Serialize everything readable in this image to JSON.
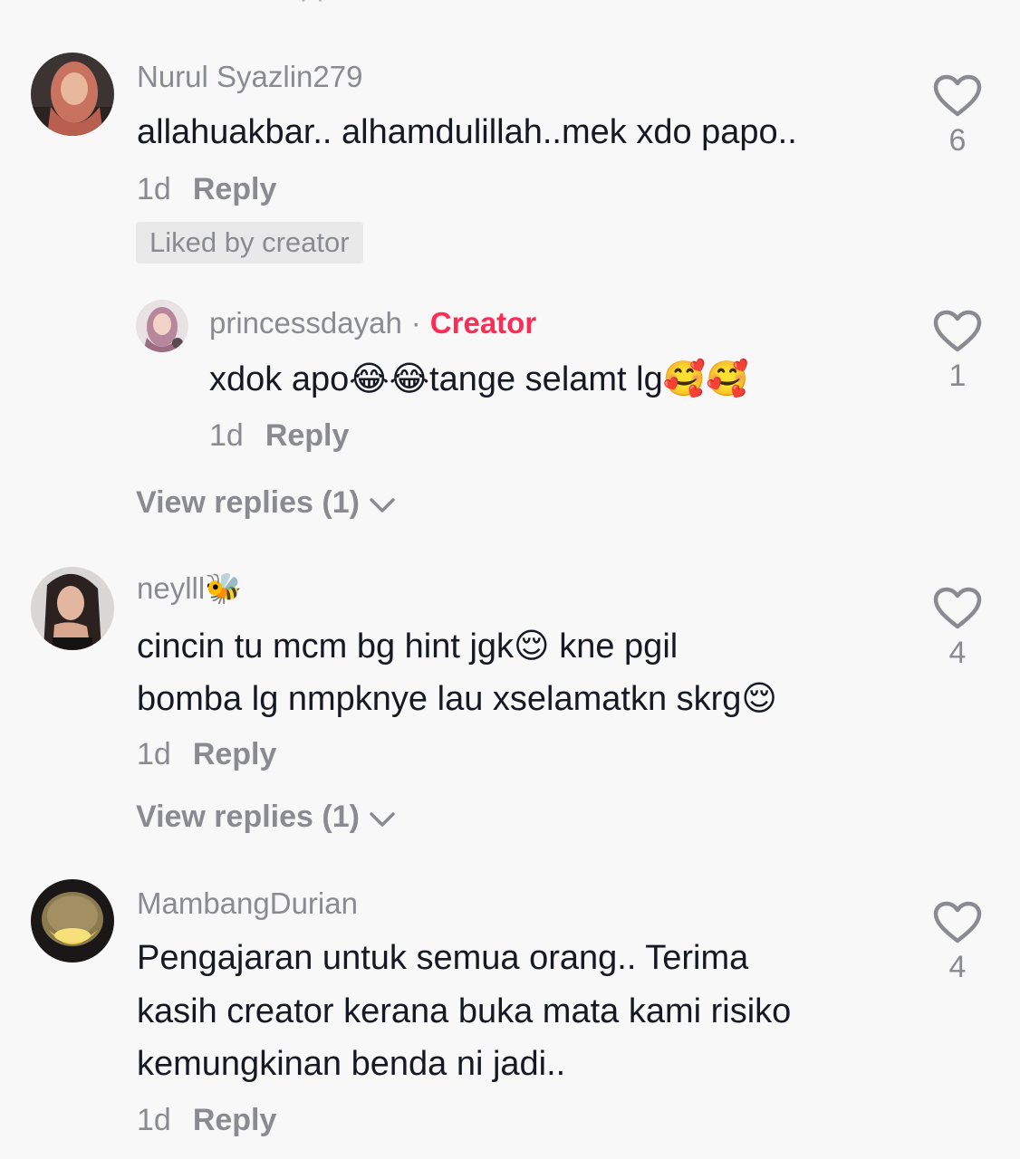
{
  "comments": [
    {
      "username": "Nurul Syazlin279",
      "text": "allahuakbar.. alhamdulillah..mek xdo papo..",
      "time": "1d",
      "reply_label": "Reply",
      "badge": "Liked by creator",
      "likes": "6"
    },
    {
      "username": "neylll🐝",
      "text_line1": "cincin tu mcm bg hint jgk😌 kne pgil",
      "text_line2": "bomba lg nmpknye lau xselamatkn skrg😌",
      "time": "1d",
      "reply_label": "Reply",
      "view_replies": "View replies (1)",
      "likes": "4"
    },
    {
      "username": "MambangDurian",
      "text_line1": "Pengajaran untuk semua orang.. Terima",
      "text_line2": "kasih creator kerana buka mata kami risiko",
      "text_line3": "kemungkinan benda ni jadi..",
      "time": "1d",
      "reply_label": "Reply",
      "likes": "4"
    }
  ],
  "creator_reply": {
    "username": "princessdayah",
    "separator": "·",
    "creator_label": "Creator",
    "text": "xdok apo😂😂tange selamt lg🥰🥰",
    "time": "1d",
    "reply_label": "Reply",
    "likes": "1"
  },
  "first_thread": {
    "view_replies": "View replies (1)"
  },
  "icons": {
    "like": "heart-outline-icon",
    "expand": "chevron-down-icon"
  },
  "colors": {
    "background": "#f8f8f8",
    "text": "#161823",
    "muted": "#8a8b91",
    "creator": "#fe2c55"
  }
}
